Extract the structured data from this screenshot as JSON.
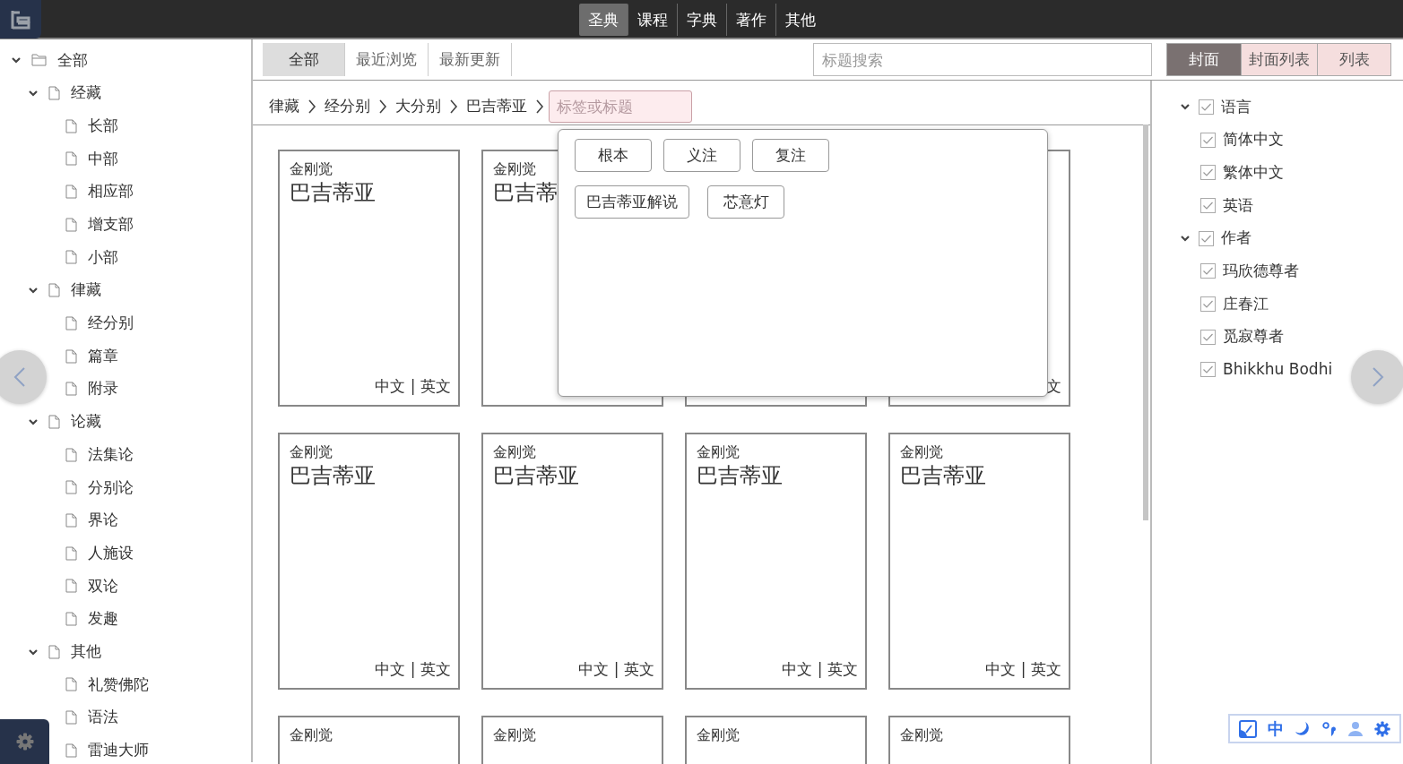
{
  "top_nav": [
    {
      "label": "圣典",
      "selected": true
    },
    {
      "label": "课程",
      "selected": false
    },
    {
      "label": "字典",
      "selected": false
    },
    {
      "label": "著作",
      "selected": false
    },
    {
      "label": "其他",
      "selected": false
    }
  ],
  "sidebar": {
    "tree": [
      {
        "label": "全部",
        "kind": "folder",
        "expanded": true,
        "children": [
          {
            "label": "经藏",
            "kind": "file",
            "expanded": true,
            "children": [
              {
                "label": "长部",
                "kind": "file"
              },
              {
                "label": "中部",
                "kind": "file"
              },
              {
                "label": "相应部",
                "kind": "file"
              },
              {
                "label": "增支部",
                "kind": "file"
              },
              {
                "label": "小部",
                "kind": "file"
              }
            ]
          },
          {
            "label": "律藏",
            "kind": "file",
            "expanded": true,
            "children": [
              {
                "label": "经分别",
                "kind": "file"
              },
              {
                "label": "篇章",
                "kind": "file"
              },
              {
                "label": "附录",
                "kind": "file"
              }
            ]
          },
          {
            "label": "论藏",
            "kind": "file",
            "expanded": true,
            "children": [
              {
                "label": "法集论",
                "kind": "file"
              },
              {
                "label": "分别论",
                "kind": "file"
              },
              {
                "label": "界论",
                "kind": "file"
              },
              {
                "label": "人施设",
                "kind": "file"
              },
              {
                "label": "双论",
                "kind": "file"
              },
              {
                "label": "发趣",
                "kind": "file"
              }
            ]
          },
          {
            "label": "其他",
            "kind": "file",
            "expanded": true,
            "children": [
              {
                "label": "礼赞佛陀",
                "kind": "file"
              },
              {
                "label": "语法",
                "kind": "file"
              },
              {
                "label": "雷迪大师",
                "kind": "file"
              }
            ]
          }
        ]
      }
    ]
  },
  "tabs": [
    {
      "label": "全部",
      "selected": true
    },
    {
      "label": "最近浏览",
      "selected": false
    },
    {
      "label": "最新更新",
      "selected": false
    }
  ],
  "search": {
    "placeholder": "标题搜索"
  },
  "views": [
    {
      "label": "封面",
      "selected": true
    },
    {
      "label": "封面列表",
      "selected": false
    },
    {
      "label": "列表",
      "selected": false
    }
  ],
  "breadcrumb": [
    "律藏",
    "经分别",
    "大分别",
    "巴吉蒂亚"
  ],
  "tag_filter": {
    "placeholder": "标签或标题"
  },
  "tag_popup": {
    "rows": [
      [
        {
          "label": "根本"
        },
        {
          "label": "义注"
        },
        {
          "label": "复注"
        }
      ],
      [
        {
          "label": "巴吉蒂亚解说"
        },
        {
          "label": "芯意灯"
        }
      ]
    ]
  },
  "cards": [
    {
      "kind": "book",
      "author": "金刚觉",
      "title": "巴吉蒂亚",
      "footer": "中文 | 英文"
    },
    {
      "kind": "book",
      "author": "金刚觉",
      "title": "巴吉蒂"
    },
    {
      "kind": "book"
    },
    {
      "kind": "book",
      "footer": "文"
    },
    {
      "kind": "book",
      "author": "金刚觉",
      "title": "巴吉蒂亚",
      "footer": "中文 | 英文"
    },
    {
      "kind": "book",
      "author": "金刚觉",
      "title": "巴吉蒂亚",
      "footer": "中文 | 英文"
    },
    {
      "kind": "book",
      "author": "金刚觉",
      "title": "巴吉蒂亚",
      "footer": "中文 | 英文"
    },
    {
      "kind": "book",
      "author": "金刚觉",
      "title": "巴吉蒂亚",
      "footer": "中文 | 英文"
    },
    {
      "kind": "book",
      "author": "金刚觉"
    },
    {
      "kind": "book",
      "author": "金刚觉"
    },
    {
      "kind": "book",
      "author": "金刚觉"
    },
    {
      "kind": "book",
      "author": "金刚觉"
    }
  ],
  "filters": [
    {
      "label": "语言",
      "checked": true,
      "expanded": true,
      "children": [
        {
          "label": "简体中文",
          "checked": true
        },
        {
          "label": "繁体中文",
          "checked": true
        },
        {
          "label": "英语",
          "checked": true
        }
      ]
    },
    {
      "label": "作者",
      "checked": true,
      "expanded": true,
      "children": [
        {
          "label": "玛欣德尊者",
          "checked": true
        },
        {
          "label": "庄春江",
          "checked": true
        },
        {
          "label": "觅寂尊者",
          "checked": true
        },
        {
          "label": "Bhikkhu Bodhi",
          "checked": true
        }
      ]
    }
  ],
  "toolbar": {
    "language": "中"
  }
}
